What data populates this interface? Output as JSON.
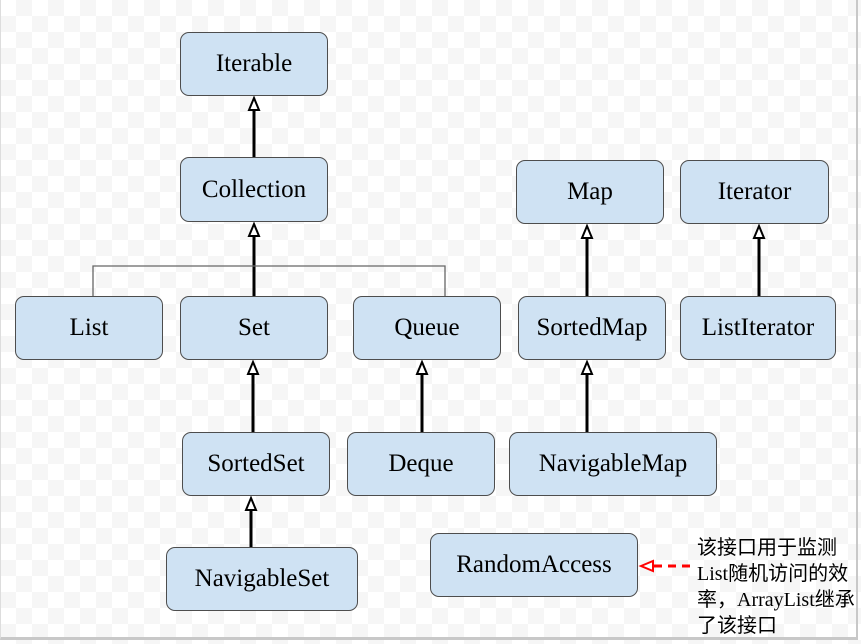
{
  "nodes": {
    "iterable": "Iterable",
    "collection": "Collection",
    "list": "List",
    "set": "Set",
    "queue": "Queue",
    "map": "Map",
    "iterator": "Iterator",
    "sortedmap": "SortedMap",
    "listiterator": "ListIterator",
    "sortedset": "SortedSet",
    "deque": "Deque",
    "navigablemap": "NavigableMap",
    "navigableset": "NavigableSet",
    "randomaccess": "RandomAccess"
  },
  "note": "该接口用于监测List随机访问的效率，ArrayList继承了该接口",
  "colors": {
    "node_fill": "#cfe2f3",
    "node_border": "#4d4d4d",
    "edge": "#000000",
    "note_arrow": "#ff0000"
  }
}
